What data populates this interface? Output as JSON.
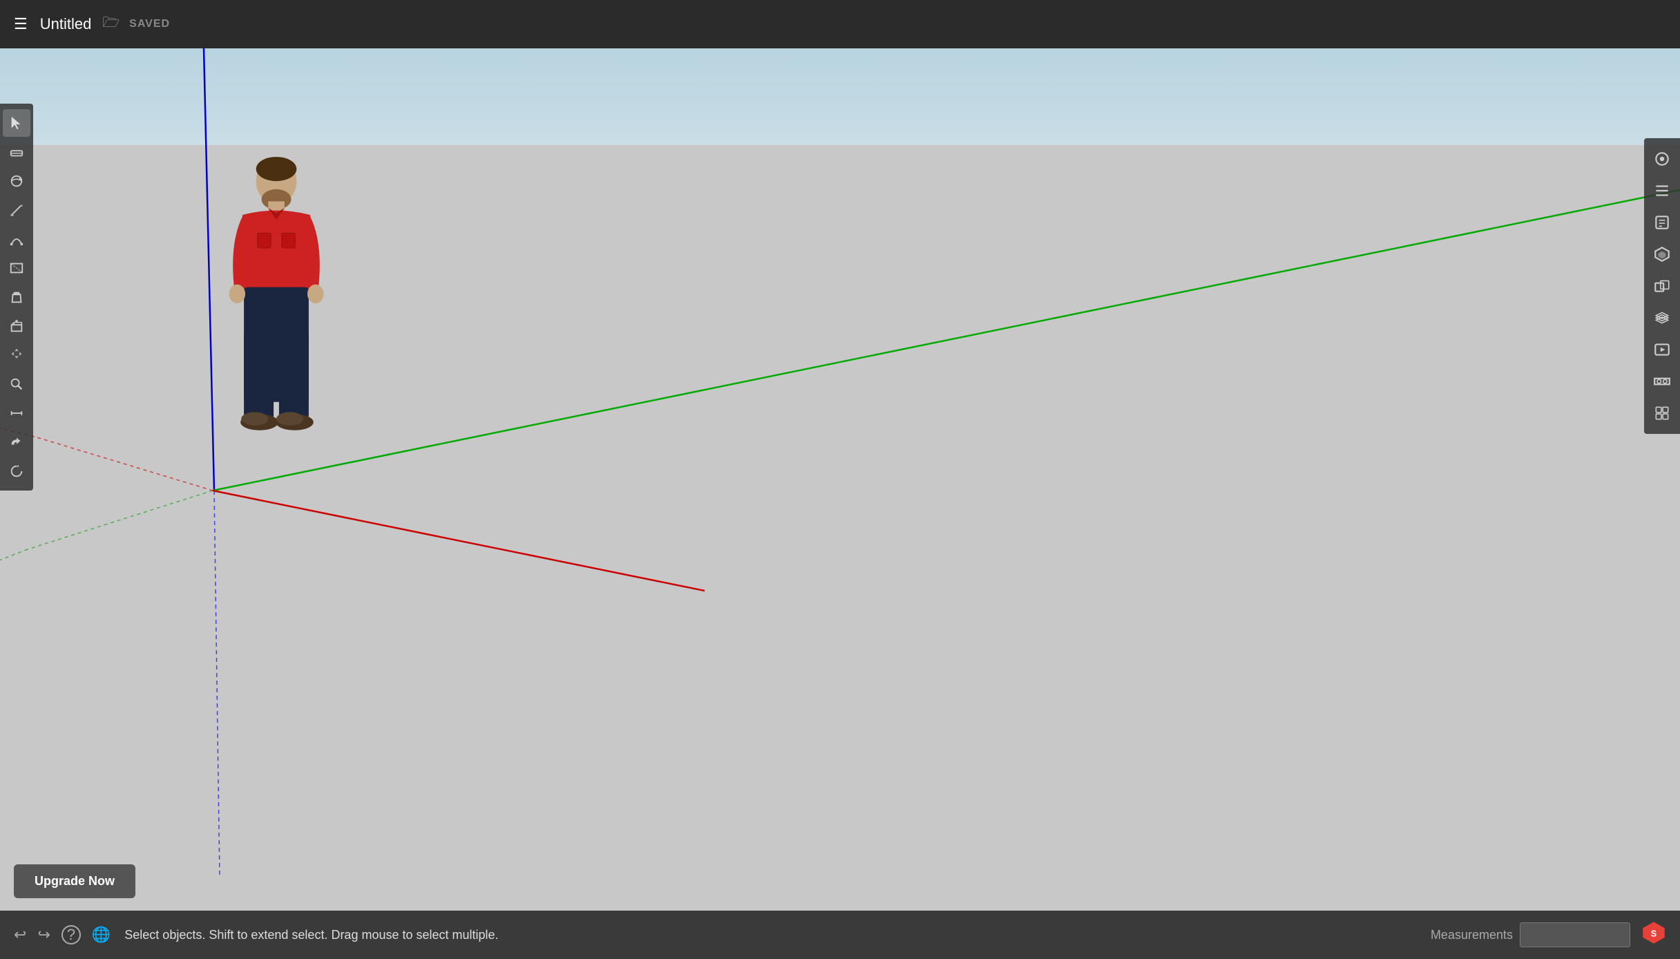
{
  "topbar": {
    "title": "Untitled",
    "saved_label": "SAVED",
    "menu_icon": "☰"
  },
  "logo": {
    "text": "SketchUp"
  },
  "statusbar": {
    "status_text": "Select objects. Shift to extend select. Drag mouse to select multiple.",
    "measurements_label": "Measurements",
    "measurements_value": ""
  },
  "upgrade": {
    "label": "Upgrade Now"
  },
  "left_tools": [
    {
      "name": "select",
      "icon": "↖"
    },
    {
      "name": "eraser",
      "icon": "⌫"
    },
    {
      "name": "orbit",
      "icon": "⟳"
    },
    {
      "name": "pencil",
      "icon": "✏"
    },
    {
      "name": "arc",
      "icon": "⌒"
    },
    {
      "name": "rectangle",
      "icon": "▭"
    },
    {
      "name": "paint",
      "icon": "🪣"
    },
    {
      "name": "pushpull",
      "icon": "⬜"
    },
    {
      "name": "move",
      "icon": "✥"
    },
    {
      "name": "zoom",
      "icon": "🔍"
    },
    {
      "name": "tape",
      "icon": "📏"
    },
    {
      "name": "follow",
      "icon": "🔗"
    },
    {
      "name": "rotate",
      "icon": "↻"
    }
  ],
  "right_tools": [
    {
      "name": "styles",
      "icon": "◎"
    },
    {
      "name": "outliner",
      "icon": "≡"
    },
    {
      "name": "instructor",
      "icon": "🎓"
    },
    {
      "name": "components",
      "icon": "⬡"
    },
    {
      "name": "solid-tools",
      "icon": "⬜"
    },
    {
      "name": "layers",
      "icon": "▤"
    },
    {
      "name": "scenes",
      "icon": "🎬"
    },
    {
      "name": "vr",
      "icon": "👓"
    },
    {
      "name": "extension",
      "icon": "⬛"
    }
  ],
  "colors": {
    "topbar_bg": "#2b2b2b",
    "toolbar_bg": "#3d3d3d",
    "sky_top": "#b8d4e0",
    "sky_bottom": "#c9dde6",
    "ground": "#c8c8c8",
    "axis_green": "#00aa00",
    "axis_red": "#cc0000",
    "axis_blue": "#0000cc",
    "axis_green_dotted": "#55aa55",
    "axis_red_dotted": "#cc4444",
    "axis_blue_dotted": "#4444cc"
  }
}
